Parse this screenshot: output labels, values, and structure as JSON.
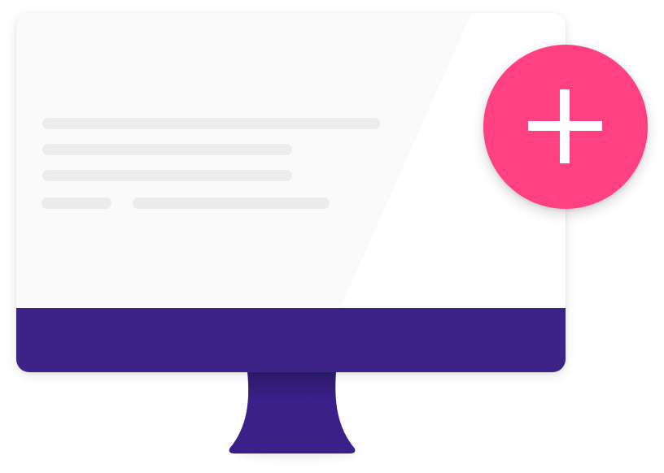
{
  "illustration": {
    "content_lines": 5,
    "colors": {
      "screen": "#fafafa",
      "screen_glare": "#ffffff",
      "placeholder_line": "#ececec",
      "bezel": "#3d2388",
      "stand": "#3a2088",
      "stand_shade": "#2e1a6e",
      "add_badge": "#ff4081",
      "add_icon": "#ffffff"
    },
    "icons": {
      "add": "plus-icon"
    }
  }
}
